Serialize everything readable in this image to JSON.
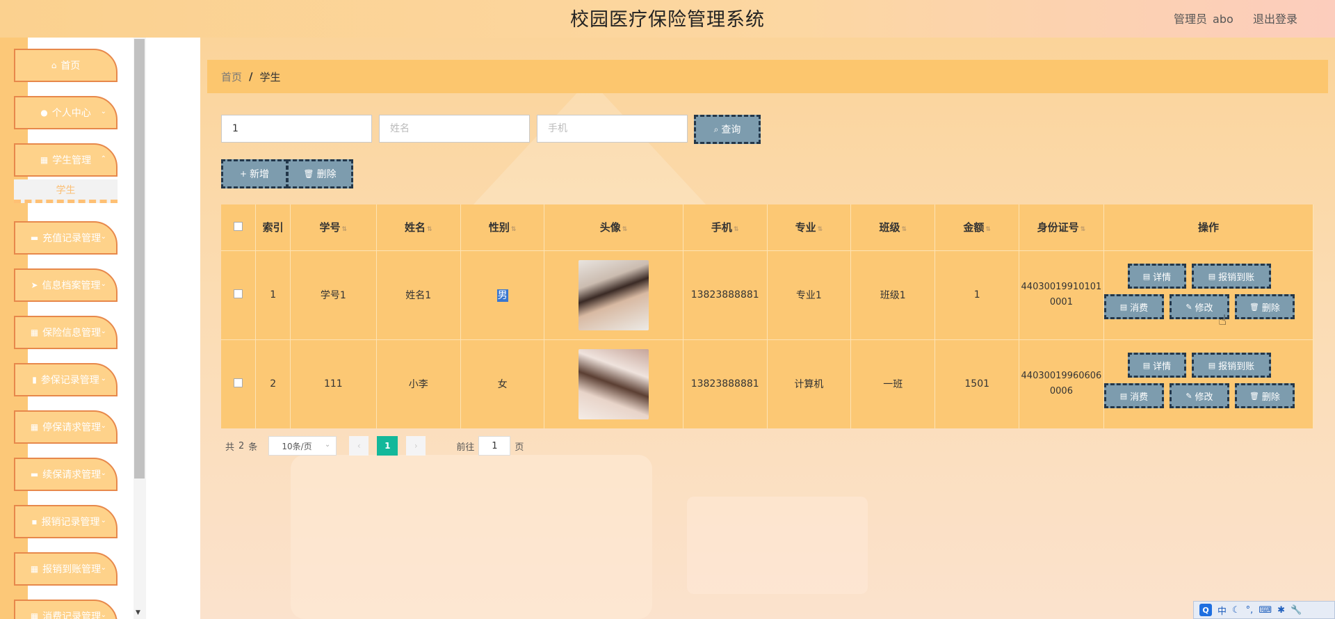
{
  "header": {
    "title": "校园医疗保险管理系统",
    "admin_label": "管理员",
    "admin_name": "abo",
    "logout": "退出登录"
  },
  "sidebar": {
    "items": [
      {
        "label": "首页",
        "icon": "home-icon"
      },
      {
        "label": "个人中心",
        "icon": "user-icon"
      },
      {
        "label": "学生管理",
        "icon": "grid-icon"
      },
      {
        "label": "充值记录管理",
        "icon": "monitor-icon"
      },
      {
        "label": "信息档案管理",
        "icon": "send-icon"
      },
      {
        "label": "保险信息管理",
        "icon": "grid-icon"
      },
      {
        "label": "参保记录管理",
        "icon": "chart-icon"
      },
      {
        "label": "停保请求管理",
        "icon": "grid-icon"
      },
      {
        "label": "续保请求管理",
        "icon": "monitor-icon"
      },
      {
        "label": "报销记录管理",
        "icon": "chat-icon"
      },
      {
        "label": "报销到账管理",
        "icon": "grid-icon"
      },
      {
        "label": "消费记录管理",
        "icon": "grid-icon"
      }
    ],
    "sub_item": "学生"
  },
  "breadcrumb": {
    "home": "首页",
    "separator": "/",
    "current": "学生"
  },
  "search": {
    "student_id_value": "1",
    "name_placeholder": "姓名",
    "phone_placeholder": "手机",
    "query_label": "查询"
  },
  "actions": {
    "add_label": "新增",
    "delete_label": "删除"
  },
  "table": {
    "headers": {
      "index": "索引",
      "student_id": "学号",
      "name": "姓名",
      "gender": "性别",
      "avatar": "头像",
      "phone": "手机",
      "major": "专业",
      "class": "班级",
      "amount": "金额",
      "id_card": "身份证号",
      "ops": "操作"
    },
    "rows": [
      {
        "index": "1",
        "student_id": "学号1",
        "name": "姓名1",
        "gender": "男",
        "phone": "13823888881",
        "major": "专业1",
        "class": "班级1",
        "amount": "1",
        "id_line1": "44030019910101",
        "id_line2": "0001"
      },
      {
        "index": "2",
        "student_id": "111",
        "name": "小李",
        "gender": "女",
        "phone": "13823888881",
        "major": "计算机",
        "class": "一班",
        "amount": "1501",
        "id_line1": "44030019960606",
        "id_line2": "0006"
      }
    ],
    "op_labels": {
      "detail": "详情",
      "reimburse": "报销到账",
      "consume": "消费",
      "edit": "修改",
      "delete": "删除"
    }
  },
  "pagination": {
    "total_prefix": "共",
    "total": "2",
    "total_suffix": "条",
    "page_size": "10条/页",
    "current_page": "1",
    "goto_label": "前往",
    "goto_value": "1",
    "page_suffix": "页"
  },
  "ime": {
    "q": "Q",
    "lang": "中"
  }
}
